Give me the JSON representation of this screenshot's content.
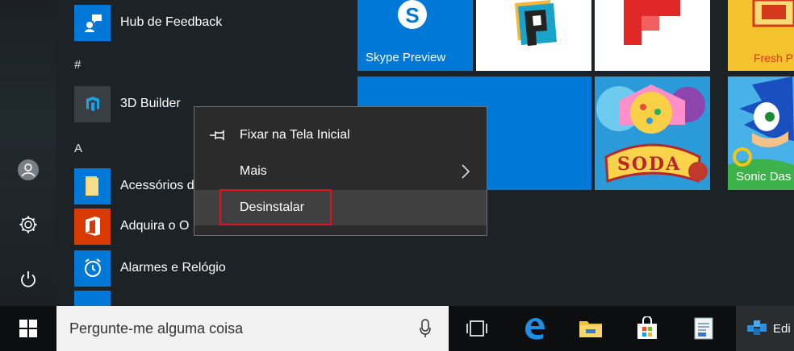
{
  "apps": {
    "hub_feedback": "Hub de Feedback",
    "section_hash": "#",
    "builder": "3D Builder",
    "section_a": "A",
    "acessorios": "Acessórios d",
    "adquira": "Adquira o O",
    "alarmes": "Alarmes e Relógio"
  },
  "tiles": {
    "skype": "Skype Preview",
    "freshpaint": "Fresh P",
    "sonic": "Sonic Das",
    "candy": "SODA"
  },
  "context_menu": {
    "pin": "Fixar na Tela Inicial",
    "more": "Mais",
    "uninstall": "Desinstalar"
  },
  "taskbar": {
    "search_placeholder": "Pergunte-me alguma coisa",
    "edit_app": "Edi"
  },
  "colors": {
    "accent": "#0078d7",
    "highlight_box": "#e0121b",
    "menu_bg": "#2b2b2b"
  }
}
